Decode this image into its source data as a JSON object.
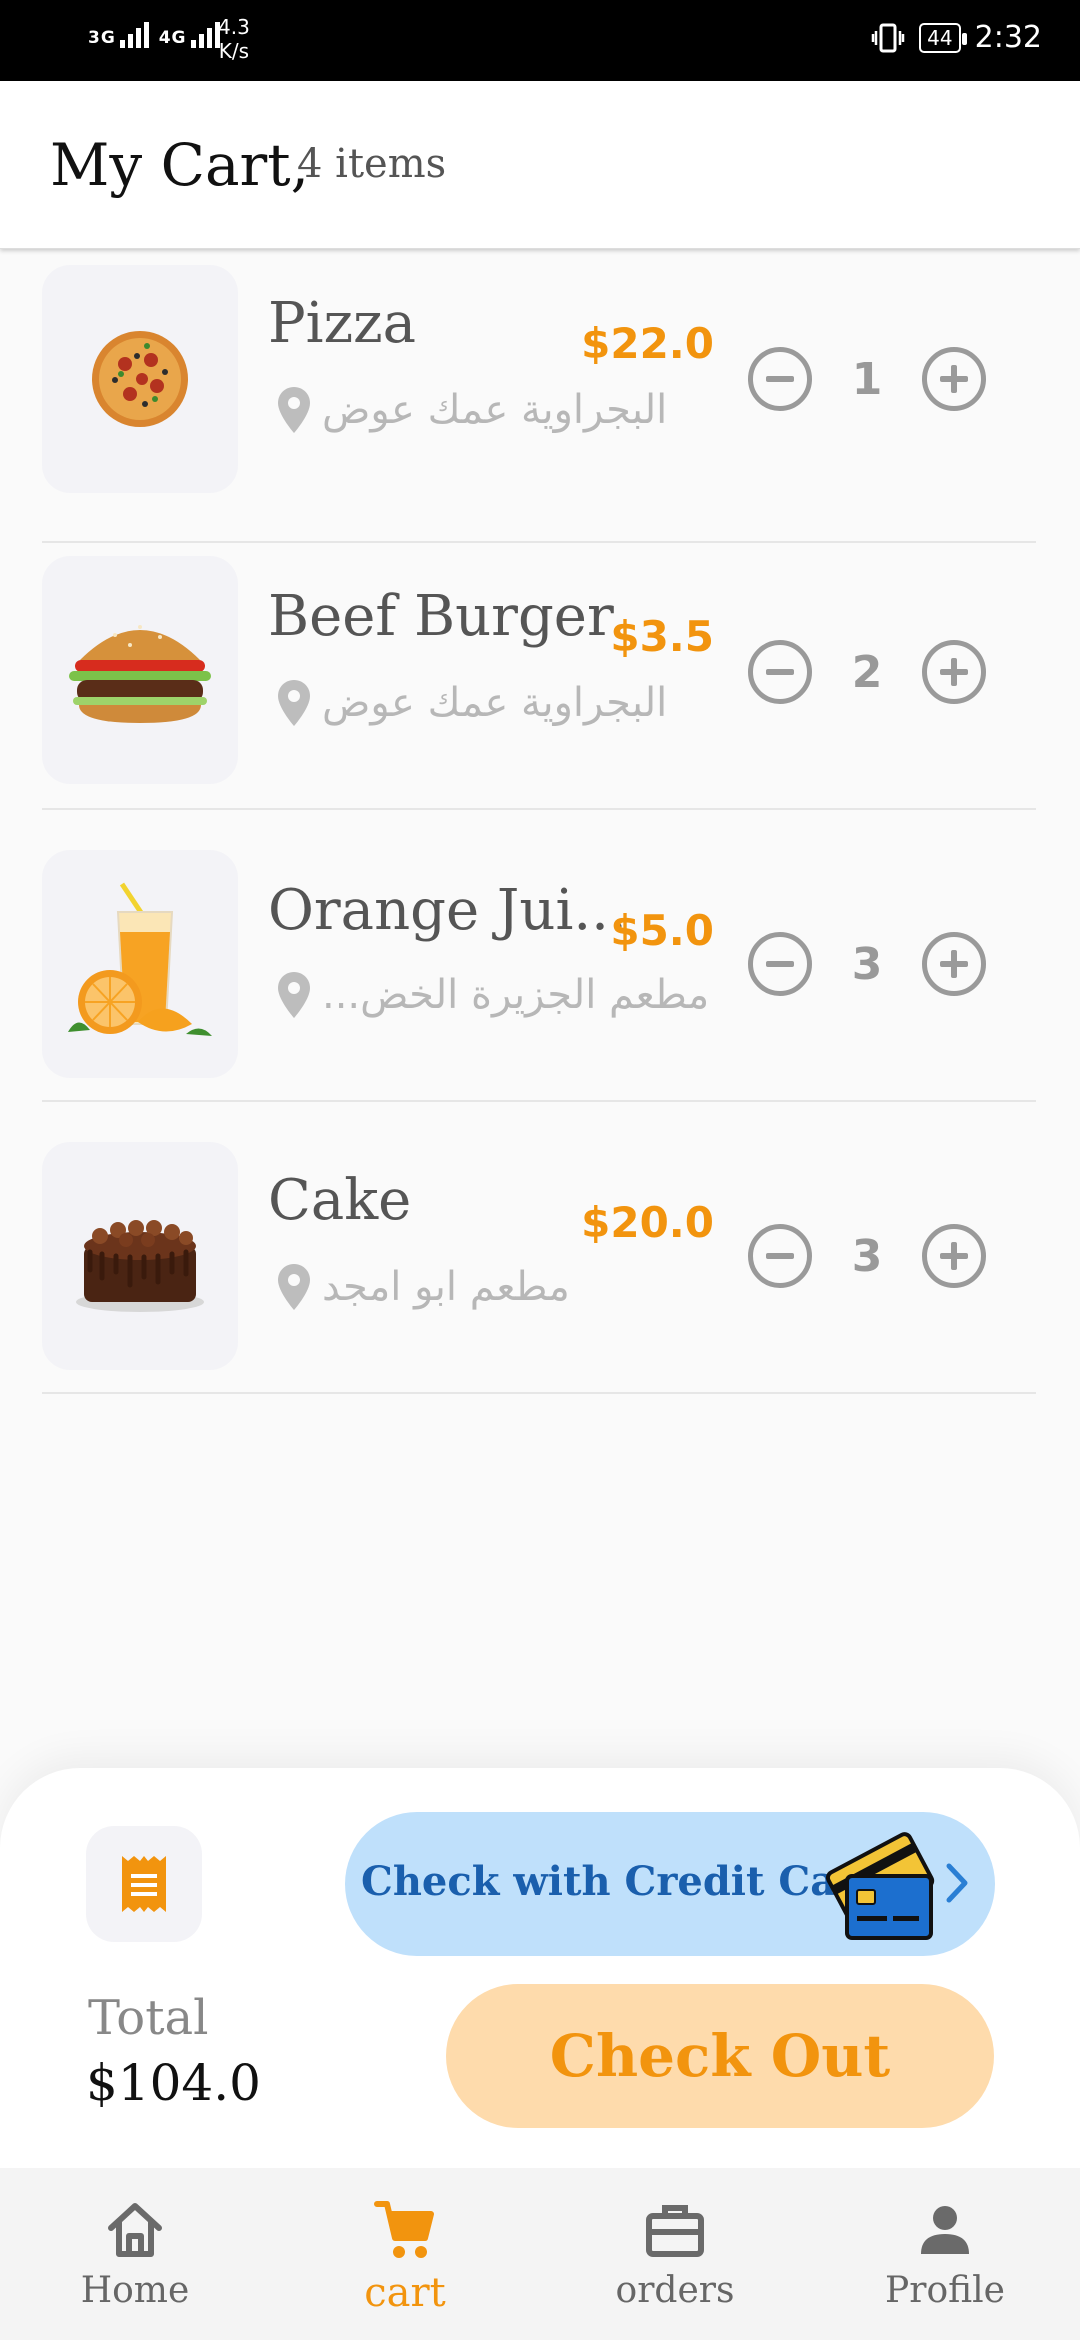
{
  "status_bar": {
    "network_1": "3G",
    "network_2": "4G",
    "speed_value": "4.3",
    "speed_unit": "K/s",
    "battery": "44",
    "time": "2:32"
  },
  "header": {
    "title": "My Cart,",
    "count": "4 items"
  },
  "items": [
    {
      "name": "Pizza",
      "price": "$22.0",
      "location": "البجراوية عمك عوض",
      "quantity": "1",
      "image_icon": "pizza-image"
    },
    {
      "name": "Beef Burger",
      "price": "$3.5",
      "location": "البجراوية عمك عوض",
      "quantity": "2",
      "image_icon": "burger-image"
    },
    {
      "name": "Orange Jui...",
      "price": "$5.0",
      "location": "مطعم الجزيرة الخض...",
      "quantity": "3",
      "image_icon": "orange-juice-image"
    },
    {
      "name": "Cake",
      "price": "$20.0",
      "location": "مطعم ابو امجد",
      "quantity": "3",
      "image_icon": "cake-image"
    }
  ],
  "checkout": {
    "credit_label": "Check with Credit Card",
    "total_label": "Total",
    "total_value": "$104.0",
    "checkout_label": "Check Out"
  },
  "nav": {
    "items": [
      {
        "label": "Home",
        "icon": "home-icon"
      },
      {
        "label": "cart",
        "icon": "cart-icon"
      },
      {
        "label": "orders",
        "icon": "briefcase-icon"
      },
      {
        "label": "Profile",
        "icon": "person-icon"
      }
    ],
    "active": "cart"
  },
  "colors": {
    "accent": "#f2940e",
    "accent_light": "#fedbac",
    "credit_bg": "#bfe0fb",
    "credit_text": "#1a5fad",
    "muted": "#9a9a9a"
  }
}
